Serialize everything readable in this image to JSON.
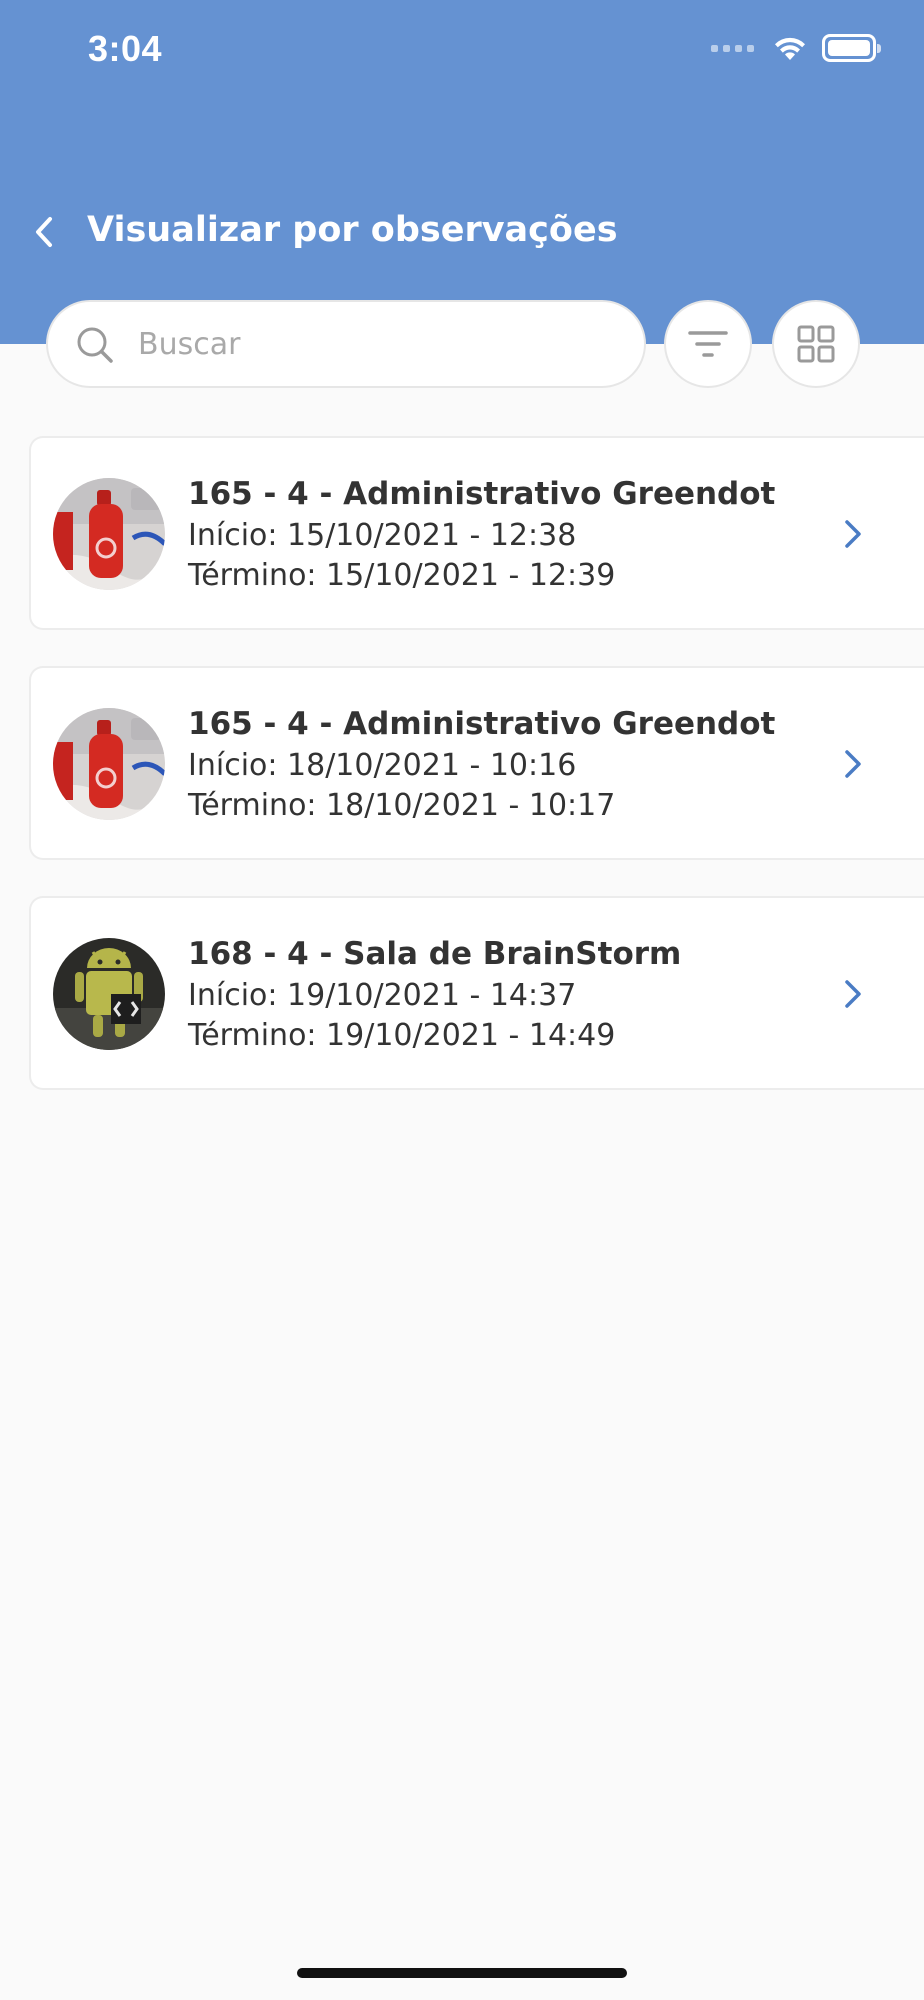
{
  "status_bar": {
    "time": "3:04"
  },
  "header": {
    "title": "Visualizar por observações"
  },
  "search": {
    "placeholder": "Buscar"
  },
  "colors": {
    "header_bg": "#6592d2",
    "accent": "#4a7cc4",
    "background": "#fafafa",
    "text": "#333333"
  },
  "icons": {
    "back": "chevron-left-icon",
    "search": "search-icon",
    "filter": "filter-icon",
    "grid": "grid-icon",
    "row": "chevron-right-icon"
  },
  "observations": [
    {
      "title": "165 - 4 - Administrativo Greendot",
      "start": "Início: 15/10/2021 - 12:38",
      "end": "Término: 15/10/2021 - 12:39",
      "thumbnail": "red-bottle"
    },
    {
      "title": "165 - 4 - Administrativo Greendot",
      "start": "Início: 18/10/2021 - 10:16",
      "end": "Término: 18/10/2021 - 10:17",
      "thumbnail": "red-bottle"
    },
    {
      "title": "168 - 4 - Sala de BrainStorm",
      "start": "Início: 19/10/2021 - 14:37",
      "end": "Término: 19/10/2021 - 14:49",
      "thumbnail": "android-figure"
    }
  ]
}
